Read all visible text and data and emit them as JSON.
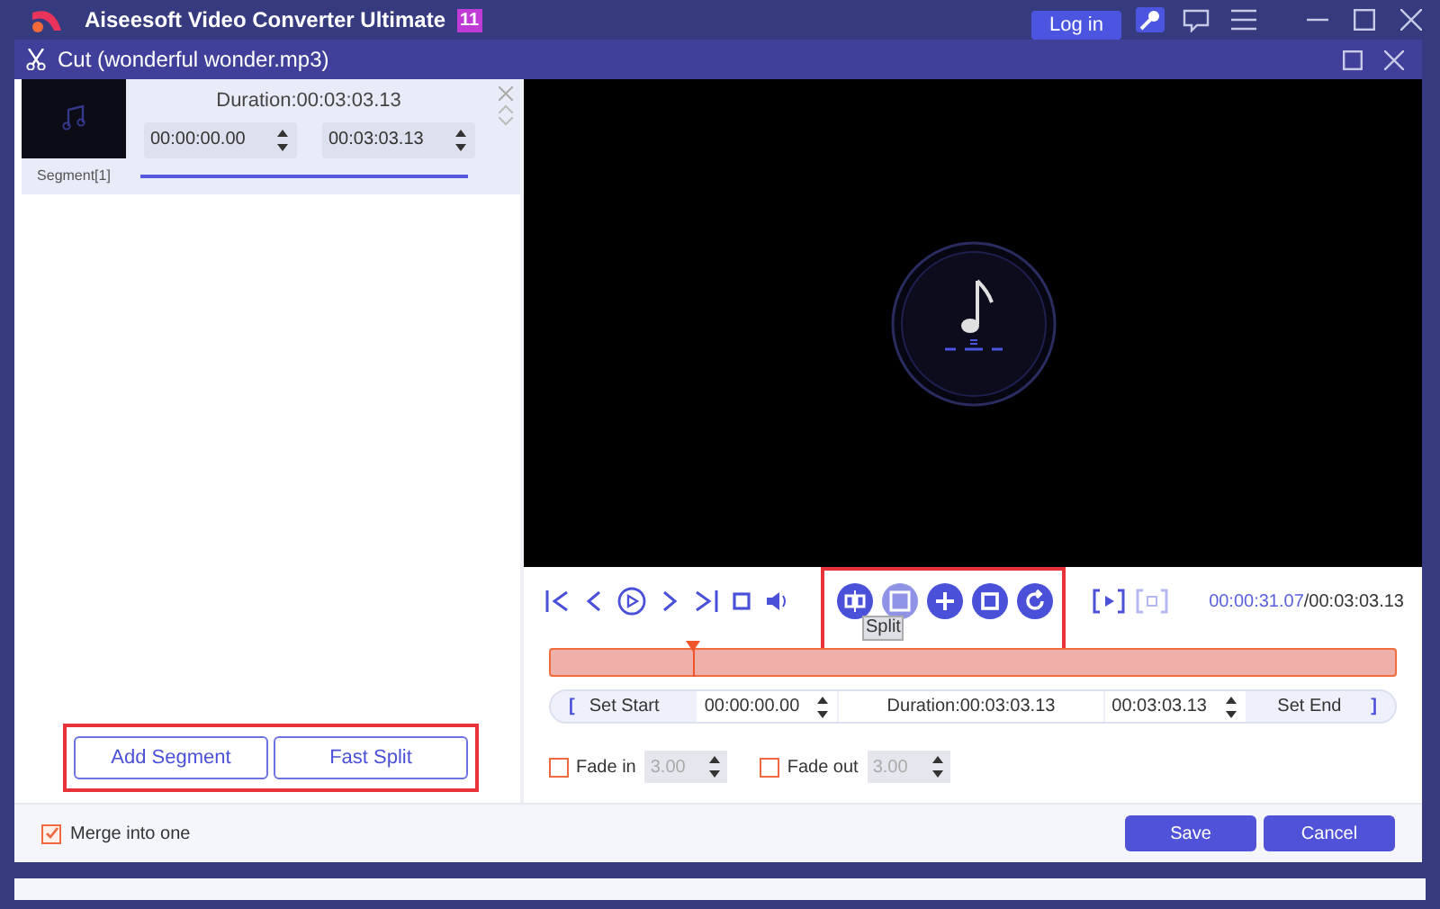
{
  "app": {
    "title": "Aiseesoft Video Converter Ultimate",
    "badge": "11",
    "login": "Log in"
  },
  "dialog": {
    "title": "Cut (wonderful wonder.mp3)"
  },
  "segment": {
    "duration": "Duration:00:03:03.13",
    "start": "00:00:00.00",
    "end": "00:03:03.13",
    "label": "Segment[1]",
    "selected": true
  },
  "segment_buttons": [
    "Add Segment",
    "Fast Split"
  ],
  "merge": {
    "label": "Merge into one",
    "checked": true
  },
  "tools": [
    {
      "kind": "split",
      "disabled": false
    },
    {
      "kind": "snapshot",
      "disabled": true
    },
    {
      "kind": "add",
      "disabled": false
    },
    {
      "kind": "copy",
      "disabled": false
    },
    {
      "kind": "reset",
      "disabled": false
    }
  ],
  "tooltip": "Split",
  "time": {
    "current": "00:00:31.07",
    "total": "/00:03:03.13"
  },
  "timeline": {
    "level": 0.17
  },
  "range": {
    "open": "[",
    "set_start": "Set Start",
    "start": "00:00:00.00",
    "duration": "Duration:00:03:03.13",
    "end": "00:03:03.13",
    "set_end": "Set End",
    "close": "]"
  },
  "fades": [
    {
      "label": "Fade in",
      "checked": false,
      "value": "3.00"
    },
    {
      "label": "Fade out",
      "checked": false,
      "value": "3.00"
    }
  ],
  "footer_buttons": [
    "Save",
    "Cancel"
  ]
}
